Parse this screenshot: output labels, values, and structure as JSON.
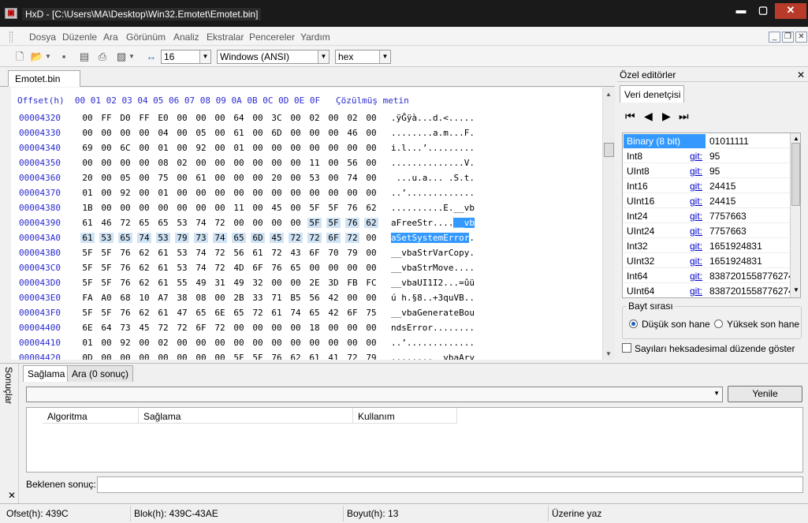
{
  "title": "HxD - [C:\\Users\\MA\\Desktop\\Win32.Emotet\\Emotet.bin]",
  "menu": [
    "Dosya",
    "Düzenle",
    "Ara",
    "Görünüm",
    "Analiz",
    "Ekstralar",
    "Pencereler",
    "Yardım"
  ],
  "toolbar": {
    "bytes_per_row": "16",
    "charset": "Windows (ANSI)",
    "offset_base": "hex"
  },
  "doc_tab": "Emotet.bin",
  "hex_header": "Offset(h)  00 01 02 03 04 05 06 07 08 09 0A 0B 0C 0D 0E 0F   Çözülmüş metin",
  "rows": [
    {
      "off": "00004320",
      "b": [
        "00",
        "FF",
        "D0",
        "FF",
        "E0",
        "00",
        "00",
        "00",
        "64",
        "00",
        "3C",
        "00",
        "02",
        "00",
        "02",
        "00"
      ],
      "t": ".ÿĞÿà...d.<....."
    },
    {
      "off": "00004330",
      "b": [
        "00",
        "00",
        "00",
        "00",
        "04",
        "00",
        "05",
        "00",
        "61",
        "00",
        "6D",
        "00",
        "00",
        "00",
        "46",
        "00"
      ],
      "t": "........a.m...F."
    },
    {
      "off": "00004340",
      "b": [
        "69",
        "00",
        "6C",
        "00",
        "01",
        "00",
        "92",
        "00",
        "01",
        "00",
        "00",
        "00",
        "00",
        "00",
        "00",
        "00"
      ],
      "t": "i.l...’........."
    },
    {
      "off": "00004350",
      "b": [
        "00",
        "00",
        "00",
        "00",
        "08",
        "02",
        "00",
        "00",
        "00",
        "00",
        "00",
        "00",
        "11",
        "00",
        "56",
        "00"
      ],
      "t": "..............V."
    },
    {
      "off": "00004360",
      "b": [
        "20",
        "00",
        "05",
        "00",
        "75",
        "00",
        "61",
        "00",
        "00",
        "00",
        "20",
        "00",
        "53",
        "00",
        "74",
        "00"
      ],
      "t": " ...u.a... .S.t."
    },
    {
      "off": "00004370",
      "b": [
        "01",
        "00",
        "92",
        "00",
        "01",
        "00",
        "00",
        "00",
        "00",
        "00",
        "00",
        "00",
        "00",
        "00",
        "00",
        "00"
      ],
      "t": "..’............."
    },
    {
      "off": "00004380",
      "b": [
        "1B",
        "00",
        "00",
        "00",
        "00",
        "00",
        "00",
        "00",
        "11",
        "00",
        "45",
        "00",
        "5F",
        "5F",
        "76",
        "62"
      ],
      "t": "..........E.__vb"
    },
    {
      "off": "00004390",
      "b": [
        "61",
        "46",
        "72",
        "65",
        "65",
        "53",
        "74",
        "72",
        "00",
        "00",
        "00",
        "00",
        "5F",
        "5F",
        "76",
        "62"
      ],
      "t": "aFreeStr....__vb"
    },
    {
      "off": "000043A0",
      "b": [
        "61",
        "53",
        "65",
        "74",
        "53",
        "79",
        "73",
        "74",
        "65",
        "6D",
        "45",
        "72",
        "72",
        "6F",
        "72",
        "00"
      ],
      "t": "aSetSystemError."
    },
    {
      "off": "000043B0",
      "b": [
        "5F",
        "5F",
        "76",
        "62",
        "61",
        "53",
        "74",
        "72",
        "56",
        "61",
        "72",
        "43",
        "6F",
        "70",
        "79",
        "00"
      ],
      "t": "__vbaStrVarCopy."
    },
    {
      "off": "000043C0",
      "b": [
        "5F",
        "5F",
        "76",
        "62",
        "61",
        "53",
        "74",
        "72",
        "4D",
        "6F",
        "76",
        "65",
        "00",
        "00",
        "00",
        "00"
      ],
      "t": "__vbaStrMove...."
    },
    {
      "off": "000043D0",
      "b": [
        "5F",
        "5F",
        "76",
        "62",
        "61",
        "55",
        "49",
        "31",
        "49",
        "32",
        "00",
        "00",
        "2E",
        "3D",
        "FB",
        "FC"
      ],
      "t": "__vbaUI1I2...=ûü"
    },
    {
      "off": "000043E0",
      "b": [
        "FA",
        "A0",
        "68",
        "10",
        "A7",
        "38",
        "08",
        "00",
        "2B",
        "33",
        "71",
        "B5",
        "56",
        "42",
        "00",
        "00"
      ],
      "t": "ú h.§8..+3quVB.."
    },
    {
      "off": "000043F0",
      "b": [
        "5F",
        "5F",
        "76",
        "62",
        "61",
        "47",
        "65",
        "6E",
        "65",
        "72",
        "61",
        "74",
        "65",
        "42",
        "6F",
        "75"
      ],
      "t": "__vbaGenerateBou"
    },
    {
      "off": "00004400",
      "b": [
        "6E",
        "64",
        "73",
        "45",
        "72",
        "72",
        "6F",
        "72",
        "00",
        "00",
        "00",
        "00",
        "18",
        "00",
        "00",
        "00"
      ],
      "t": "ndsError........"
    },
    {
      "off": "00004410",
      "b": [
        "01",
        "00",
        "92",
        "00",
        "02",
        "00",
        "00",
        "00",
        "00",
        "00",
        "00",
        "00",
        "00",
        "00",
        "00",
        "00"
      ],
      "t": "..’............."
    },
    {
      "off": "00004420",
      "b": [
        "0D",
        "00",
        "00",
        "00",
        "00",
        "00",
        "00",
        "00",
        "5F",
        "5F",
        "76",
        "62",
        "61",
        "41",
        "72",
        "79"
      ],
      "t": "........__vbaAry"
    },
    {
      "off": "00004430",
      "b": [
        "44",
        "65",
        "73",
        "74",
        "72",
        "75",
        "63",
        "74",
        "00",
        "00",
        "00",
        "00",
        "5F",
        "5F",
        "76",
        "62"
      ],
      "t": "Destruct....__vb"
    },
    {
      "off": "00004440",
      "b": [
        "61",
        "41",
        "72",
        "79",
        "43",
        "6F",
        "6E",
        "73",
        "74",
        "72",
        "75",
        "63",
        "74",
        "32",
        "00",
        "00"
      ],
      "t": "aAryConstruct2.."
    },
    {
      "off": "00004450",
      "b": [
        "57",
        "09",
        "C4",
        "9A",
        "0E",
        "BF",
        "90",
        "4E",
        "BF",
        "BB",
        "DF",
        "7E",
        "B3",
        "D0",
        "AD",
        "01"
      ],
      "t": "W.Äš.¿.N¿»ß~³Ğ.."
    }
  ],
  "right_panel": {
    "title": "Özel editörler",
    "tab": "Veri denetçisi",
    "goto": "git:",
    "inspector": [
      {
        "name": "Binary (8 bit)",
        "value": "01011111"
      },
      {
        "name": "Int8",
        "value": "95"
      },
      {
        "name": "UInt8",
        "value": "95"
      },
      {
        "name": "Int16",
        "value": "24415"
      },
      {
        "name": "UInt16",
        "value": "24415"
      },
      {
        "name": "Int24",
        "value": "7757663"
      },
      {
        "name": "UInt24",
        "value": "7757663"
      },
      {
        "name": "Int32",
        "value": "1651924831"
      },
      {
        "name": "UInt32",
        "value": "1651924831"
      },
      {
        "name": "Int64",
        "value": "8387201558776274783"
      },
      {
        "name": "UInt64",
        "value": "8387201558776274783"
      }
    ],
    "byte_order": "Bayt sırası",
    "little_endian": "Düşük son hane",
    "big_endian": "Yüksek son hane",
    "hex_check": "Sayıları heksadesimal düzende göster"
  },
  "bottom": {
    "side_label": "Sonuçlar",
    "tab_checksum": "Sağlama",
    "tab_search": "Ara (0 sonuç)",
    "refresh": "Yenile",
    "col_algorithm": "Algoritma",
    "col_checksum": "Sağlama",
    "col_usage": "Kullanım",
    "expected": "Beklenen sonuç:"
  },
  "status": {
    "offset": "Ofset(h): 439C",
    "block": "Blok(h): 439C-43AE",
    "size": "Boyut(h): 13",
    "mode": "Üzerine yaz"
  },
  "colors": {
    "offset_blue": "#2a2ad0",
    "selection": "#3399ff"
  }
}
